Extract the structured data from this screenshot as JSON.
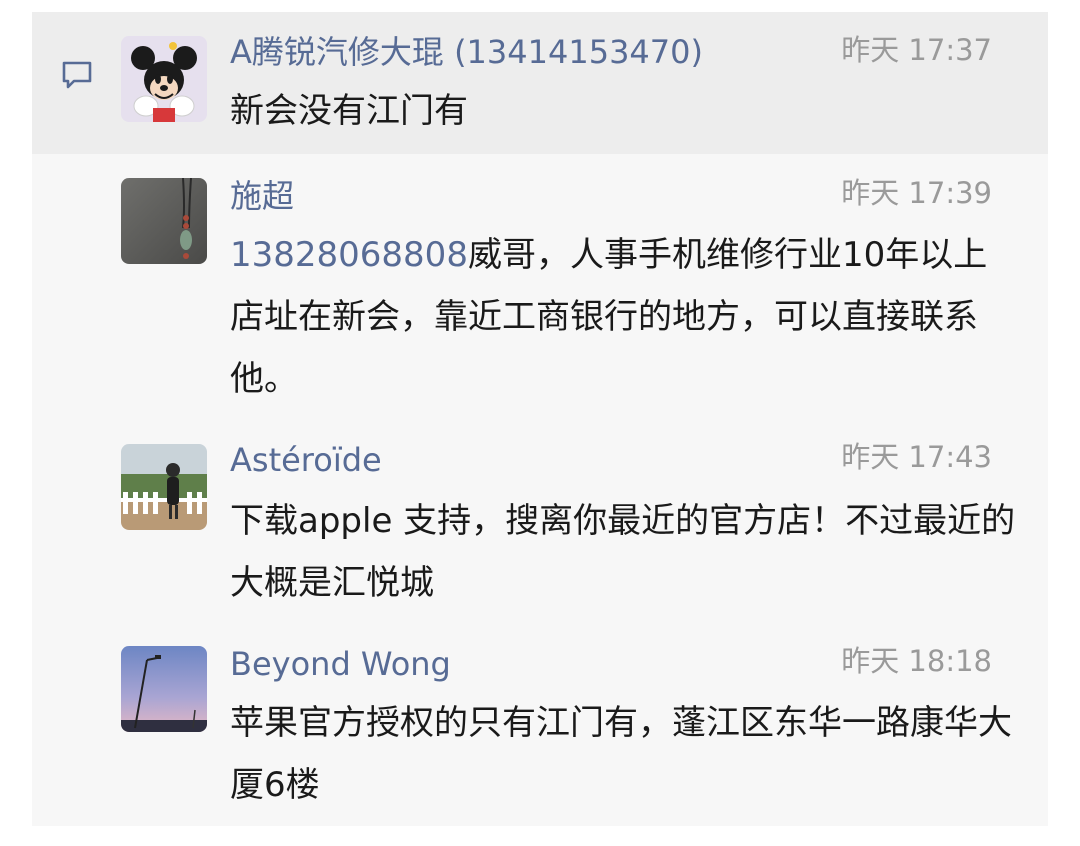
{
  "comments": [
    {
      "author": "A腾锐汽修大琨 (13414153470)",
      "time": "昨天 17:37",
      "text": "新会没有江门有",
      "avatar_icon": "mickey-mouse-avatar"
    },
    {
      "author": "施超",
      "time": "昨天 17:39",
      "phone": "13828068808",
      "text": "威哥，人事手机维修行业10年以上 店址在新会，靠近工商银行的地方，可以直接联系他。",
      "avatar_icon": "pendant-photo-avatar"
    },
    {
      "author": "Astéroïde",
      "time": "昨天 17:43",
      "text": "下载apple 支持，搜离你最近的官方店！不过最近的大概是汇悦城",
      "avatar_icon": "girl-fence-photo-avatar"
    },
    {
      "author": "Beyond  Wong",
      "time": "昨天 18:18",
      "text": "苹果官方授权的只有江门有，蓬江区东华一路康华大厦6楼",
      "avatar_icon": "sunset-streetlight-avatar"
    }
  ],
  "colors": {
    "name": "#576b95",
    "time": "#9a9a9a",
    "text": "#1a1a1a",
    "panel": "#f7f7f7",
    "highlight": "#ededed"
  }
}
